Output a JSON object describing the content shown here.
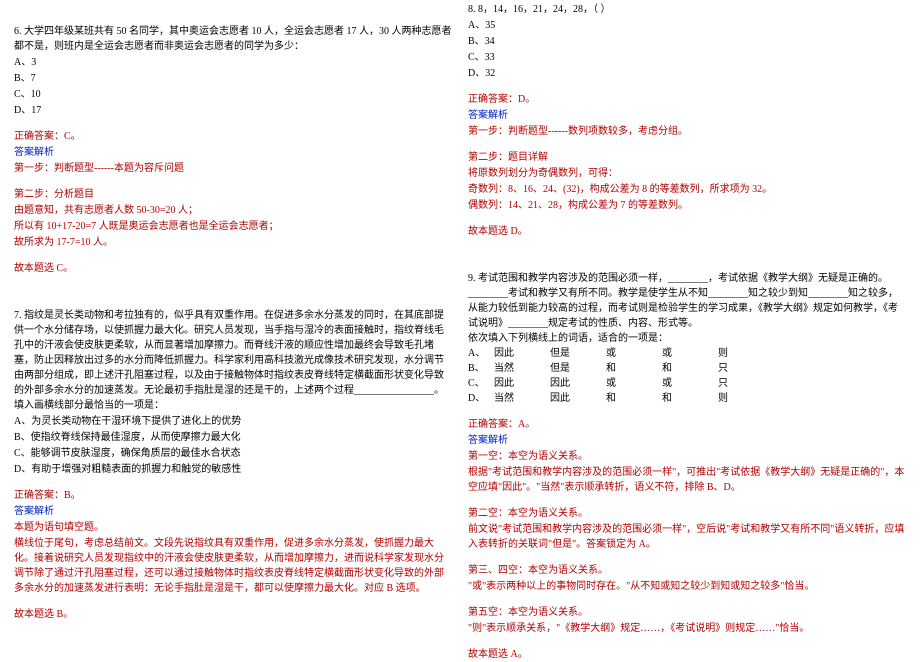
{
  "left": {
    "q6": {
      "stem": "6. 大学四年级某班共有 50 名同学，其中奥运会志愿者 10 人，全运会志愿者 17 人，30 人两种志愿者都不是，则班内是全运会志愿者而非奥运会志愿者的同学为多少：",
      "opts": [
        "A、3",
        "B、7",
        "C、10",
        "D、17"
      ],
      "correct": "正确答案：C。",
      "expHeader": "答案解析",
      "step1": "第一步：判断题型------本题为容斥问题",
      "step2h": "第二步：分析题目",
      "step2a": "由题意知，共有志愿者人数 50-30=20 人；",
      "step2b": "所以有 10+17-20=7 人既是奥运会志愿者也是全运会志愿者；",
      "step2c": "故所求为 17-7=10 人。",
      "final": "故本题选 C。"
    },
    "q7": {
      "stem1": "7. 指纹是灵长类动物和考拉独有的，似乎具有双重作用。在促进多余水分蒸发的同时，在其底部提供一个水分储存场，以使抓握力最大化。研究人员发现，当手指与湿冷的表面接触时，指纹脊线毛孔中的汗液会使皮肤更柔软，从而显著增加摩擦力。而脊线汗液的顺应性增加最终会导致毛孔堵塞，防止因释放出过多的水分而降低抓握力。科学家利用高科技激光成像技术研究发现，水分调节由两部分组成，即上述汗孔阻塞过程，以及由于接触物体时指纹表皮脊线特定横截面形状变化导致的外部多余水分的加速蒸发。无论最初手指肚是湿的还是干的，上述两个过程________________。",
      "stem2": "填入画横线部分最恰当的一项是：",
      "opts": [
        "A、为灵长类动物在干湿环境下提供了进化上的优势",
        "B、使指纹脊线保持最佳湿度，从而使摩擦力最大化",
        "C、能够调节皮肤湿度，确保角质层的最佳水合状态",
        "D、有助于增强对粗糙表面的抓握力和触觉的敏感性"
      ],
      "correct": "正确答案：B。",
      "expHeader": "答案解析",
      "tag": "本题为语句填空题。",
      "exp1": "横线位于尾句，考虑总结前文。文段先说指纹具有双重作用，促进多余水分蒸发，使抓握力最大化。接着说研究人员发现指纹中的汗液会使皮肤更柔软，从而增加摩擦力，进而说科学家发现水分调节除了通过汗孔阻塞过程，还可以通过接触物体时指纹表皮脊线特定横截面形状变化导致的外部多余水分的加速蒸发进行表明：无论手指肚是湿是干，都可以使摩擦力最大化。对应 B 选项。",
      "final": "故本题选 B。"
    }
  },
  "right": {
    "q8": {
      "stem": "8. 8，14，16，21，24，28，（    ）",
      "opts": [
        "A、35",
        "B、34",
        "C、33",
        "D、32"
      ],
      "correct": "正确答案：D。",
      "expHeader": "答案解析",
      "step1": "第一步：判断题型------数列项数较多，考虑分组。",
      "step2h": "第二步：题目详解",
      "step2a": "将原数列划分为奇偶数列，可得：",
      "step2b": "奇数列：8、16、24、(32)，构成公差为 8 的等差数列，所求项为 32。",
      "step2c": "偶数列：14、21、28，构成公差为 7 的等差数列。",
      "final": "故本题选 D。"
    },
    "q9": {
      "stem1": "9. 考试范围和教学内容涉及的范围必须一样，________，考试依据《教学大纲》无疑是正确的。________考试和教学又有所不同。教学是使学生从不知________知之较少到知________知之较多，从能力较低到能力较高的过程，而考试则是检验学生的学习成果，《教学大纲》规定如何教学，《考试说明》________规定考试的性质、内容、形式等。",
      "stem2": "依次填入下列横线上的词语，适合的一项是：",
      "grid": [
        [
          "A、",
          "因此",
          "但是",
          "或",
          "或",
          "则"
        ],
        [
          "B、",
          "当然",
          "但是",
          "和",
          "和",
          "只"
        ],
        [
          "C、",
          "因此",
          "因此",
          "或",
          "或",
          "只"
        ],
        [
          "D、",
          "当然",
          "因此",
          "和",
          "和",
          "则"
        ]
      ],
      "correct": "正确答案：A。",
      "expHeader": "答案解析",
      "sec1h": "第一空：本空为语义关系。",
      "sec1": "根据\"考试范围和教学内容涉及的范围必须一样\"，可推出\"考试依据《教学大纲》无疑是正确的\"，本空应填\"因此\"。\"当然\"表示顺承转折，语义不符，排除 B、D。",
      "sec2h": "第二空：本空为语义关系。",
      "sec2": "前文说\"考试范围和教学内容涉及的范围必须一样\"，空后说\"考试和教学又有所不同\"语义转折，应填入表转折的关联词\"但是\"。答案锁定为 A。",
      "sec3h": "第三、四空：本空为语义关系。",
      "sec3": "\"或\"表示两种以上的事物同时存在。\"从不知或知之较少到知或知之较多\"恰当。",
      "sec4h": "第五空：本空为语义关系。",
      "sec4": "\"则\"表示顺承关系，\"《教学大纲》规定……，《考试说明》则规定……\"恰当。",
      "final": "故本题选 A。"
    }
  }
}
